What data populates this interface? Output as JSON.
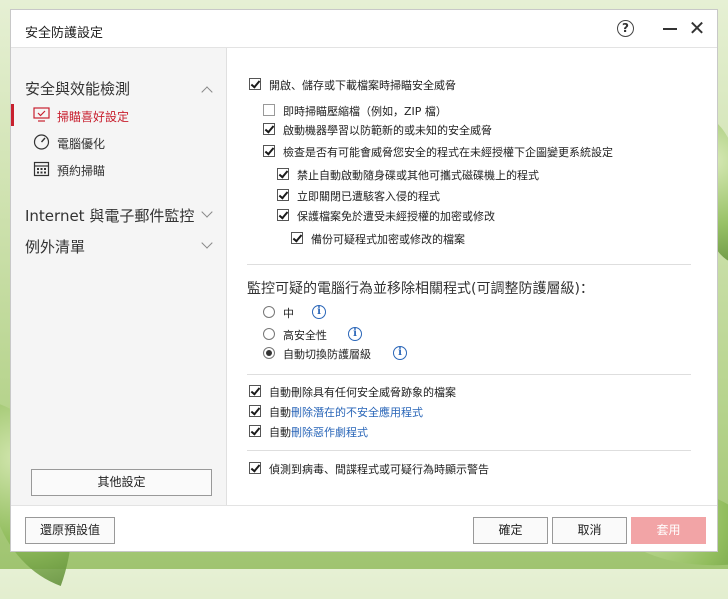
{
  "window": {
    "title": "安全防護設定"
  },
  "sidebar": {
    "sections": [
      {
        "label": "安全與效能檢測",
        "expanded": true
      },
      {
        "label": "Internet 與電子郵件監控",
        "expanded": false
      },
      {
        "label": "例外清單",
        "expanded": false
      }
    ],
    "items": [
      {
        "label": "掃瞄喜好設定",
        "icon": "monitor-scan-icon",
        "active": true
      },
      {
        "label": "電腦優化",
        "icon": "speedometer-icon",
        "active": false
      },
      {
        "label": "預約掃瞄",
        "icon": "calendar-icon",
        "active": false
      }
    ],
    "other_settings": "其他設定"
  },
  "content": {
    "options": [
      {
        "label": "開啟、儲存或下載檔案時掃瞄安全威脅",
        "checked": true
      },
      {
        "label": "即時掃瞄壓縮檔（例如，ZIP 檔）",
        "checked": false
      },
      {
        "label": "啟動機器學習以防範新的或未知的安全威脅",
        "checked": true
      },
      {
        "label": "檢查是否有可能會威脅您安全的程式在未經授權下企圖變更系統設定",
        "checked": true
      },
      {
        "label": "禁止自動啟動隨身碟或其他可攜式磁碟機上的程式",
        "checked": true
      },
      {
        "label": "立即關閉已遭駭客入侵的程式",
        "checked": true
      },
      {
        "label": "保護檔案免於遭受未經授權的加密或修改",
        "checked": true
      },
      {
        "label": "備份可疑程式加密或修改的檔案",
        "checked": true
      }
    ],
    "behavior_heading": "監控可疑的電腦行為並移除相關程式(可調整防護層級)：",
    "levels": [
      {
        "label": "中",
        "selected": false
      },
      {
        "label": "高安全性",
        "selected": false
      },
      {
        "label": "自動切換防護層級",
        "selected": true
      }
    ],
    "auto_delete": {
      "label_1": "自動刪除具有任何安全威脅跡象的檔案",
      "prefix": "自動",
      "link_2": "刪除潛在的不安全應用程式",
      "link_3": "刪除惡作劇程式"
    },
    "warn_label": "偵測到病毒、間諜程式或可疑行為時顯示警告"
  },
  "footer": {
    "restore": "還原預設值",
    "ok": "確定",
    "cancel": "取消",
    "apply": "套用"
  },
  "colors": {
    "accent_red": "#c8202f",
    "link_blue": "#2a66b8",
    "apply_disabled": "#f2a4a6"
  }
}
